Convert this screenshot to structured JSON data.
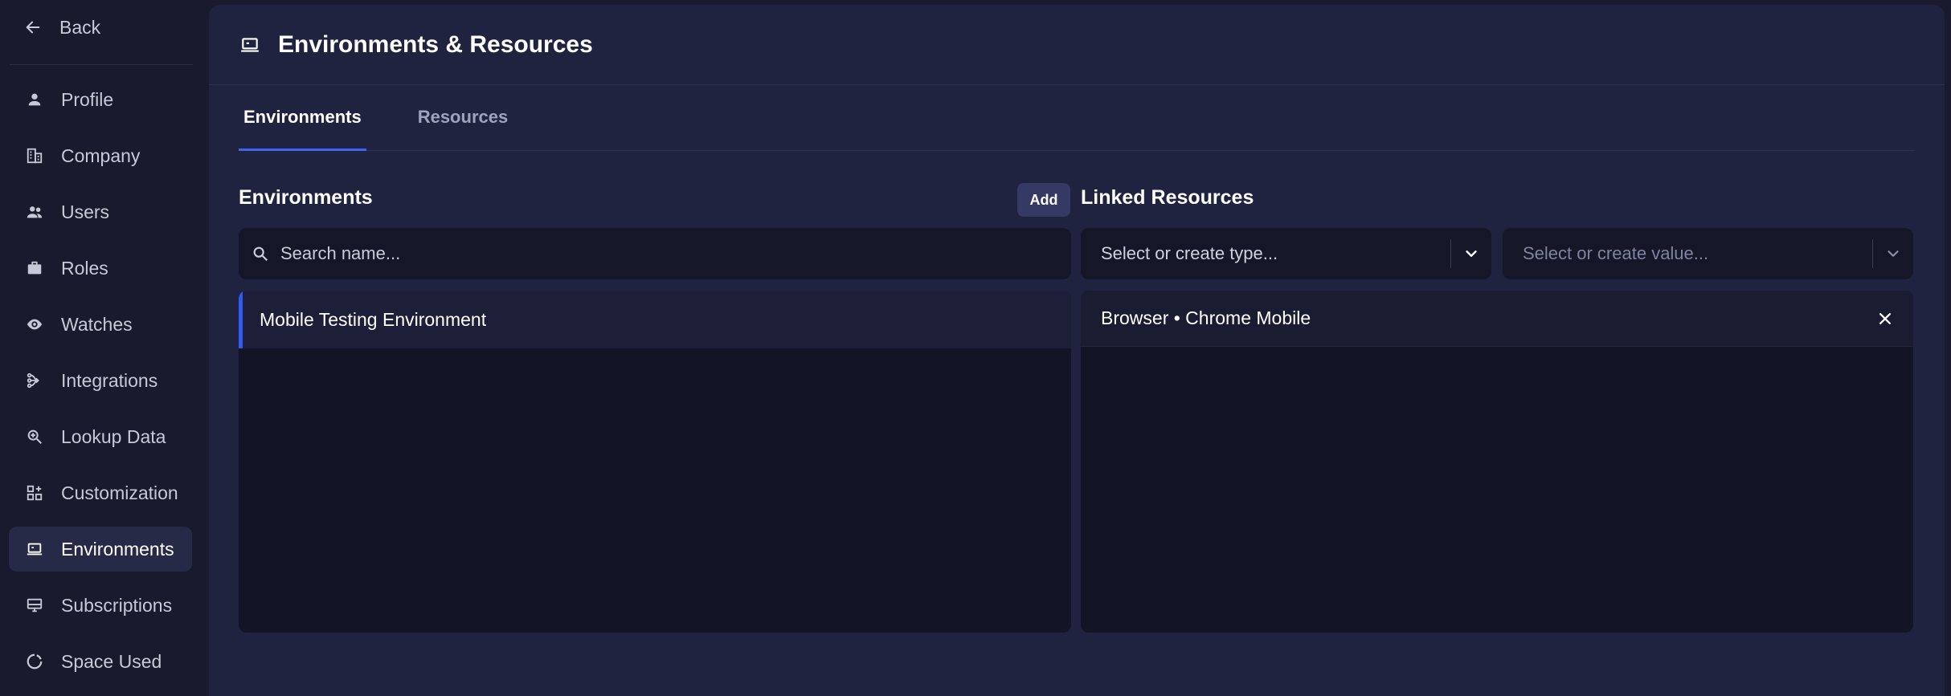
{
  "sidebar": {
    "back_label": "Back",
    "items": [
      {
        "label": "Profile",
        "icon": "person-icon"
      },
      {
        "label": "Company",
        "icon": "building-icon"
      },
      {
        "label": "Users",
        "icon": "users-icon"
      },
      {
        "label": "Roles",
        "icon": "briefcase-icon"
      },
      {
        "label": "Watches",
        "icon": "eye-icon"
      },
      {
        "label": "Integrations",
        "icon": "integration-icon"
      },
      {
        "label": "Lookup Data",
        "icon": "search-zoom-icon"
      },
      {
        "label": "Customization",
        "icon": "widgets-icon"
      },
      {
        "label": "Environments",
        "icon": "laptop-icon",
        "active": true
      },
      {
        "label": "Subscriptions",
        "icon": "monitor-icon"
      },
      {
        "label": "Space Used",
        "icon": "donut-icon"
      }
    ]
  },
  "header": {
    "title": "Environments & Resources",
    "icon": "laptop-icon"
  },
  "tabs": [
    {
      "label": "Environments",
      "active": true
    },
    {
      "label": "Resources",
      "active": false
    }
  ],
  "environments": {
    "title": "Environments",
    "add_label": "Add",
    "search_placeholder": "Search name...",
    "items": [
      "Mobile Testing Environment"
    ]
  },
  "linked_resources": {
    "title": "Linked Resources",
    "type_placeholder": "Select or create type...",
    "value_placeholder": "Select or create value...",
    "items": [
      "Browser • Chrome Mobile"
    ]
  },
  "colors": {
    "accent": "#3c63f2",
    "background": "#191a2e",
    "panel": "#1f2340"
  }
}
